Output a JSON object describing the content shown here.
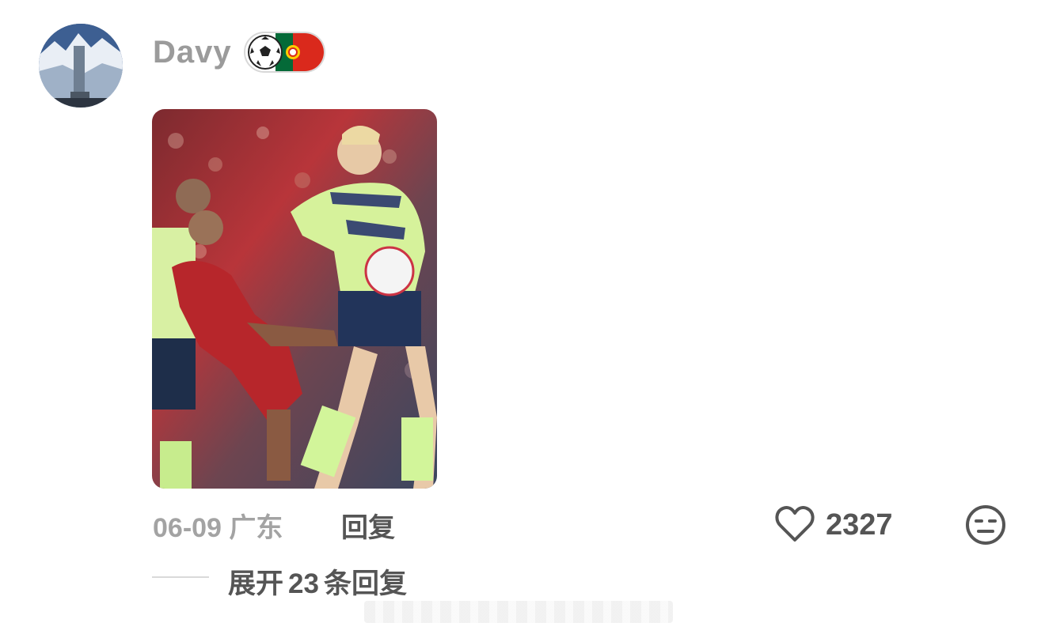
{
  "comment": {
    "username": "Davy",
    "badge_icons": [
      "soccer-ball-icon",
      "portugal-flag-icon"
    ],
    "date": "06-09",
    "location": "广东",
    "reply_label": "回复",
    "like_count": "2327",
    "expand": {
      "prefix": "展开",
      "count": "23",
      "suffix": "条回复"
    }
  },
  "colors": {
    "username": "#9b9b9b",
    "meta": "#a3a3a3",
    "action": "#555555",
    "portugal_green": "#046a38",
    "portugal_red": "#da291c"
  }
}
